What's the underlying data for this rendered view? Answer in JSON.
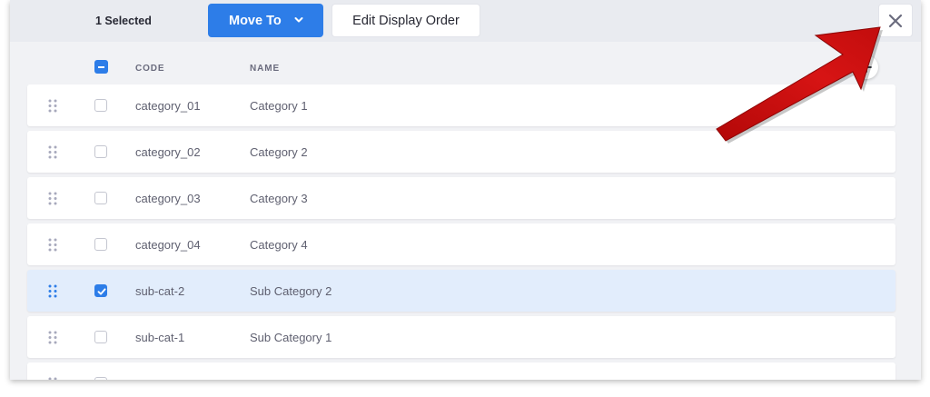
{
  "management_bar": {
    "selected_label": "1 Selected",
    "move_to_label": "Move To",
    "edit_display_order_label": "Edit Display Order",
    "close_icon": "close-icon"
  },
  "table": {
    "columns": {
      "code": "CODE",
      "name": "NAME"
    },
    "header_checkbox_state": "indeterminate",
    "add_column_icon": "plus-icon",
    "rows": [
      {
        "code": "category_01",
        "name": "Category 1",
        "checked": false
      },
      {
        "code": "category_02",
        "name": "Category 2",
        "checked": false
      },
      {
        "code": "category_03",
        "name": "Category 3",
        "checked": false
      },
      {
        "code": "category_04",
        "name": "Category 4",
        "checked": false
      },
      {
        "code": "sub-cat-2",
        "name": "Sub Category 2",
        "checked": true
      },
      {
        "code": "sub-cat-1",
        "name": "Sub Category 1",
        "checked": false
      },
      {
        "code": "",
        "name": "",
        "checked": false
      }
    ]
  },
  "annotation": {
    "arrow_color": "#c80f0f",
    "points_to": "close-button"
  },
  "colors": {
    "primary": "#2d7de8",
    "active_row": "#e2edfc",
    "bar": "#e9ebf0"
  }
}
